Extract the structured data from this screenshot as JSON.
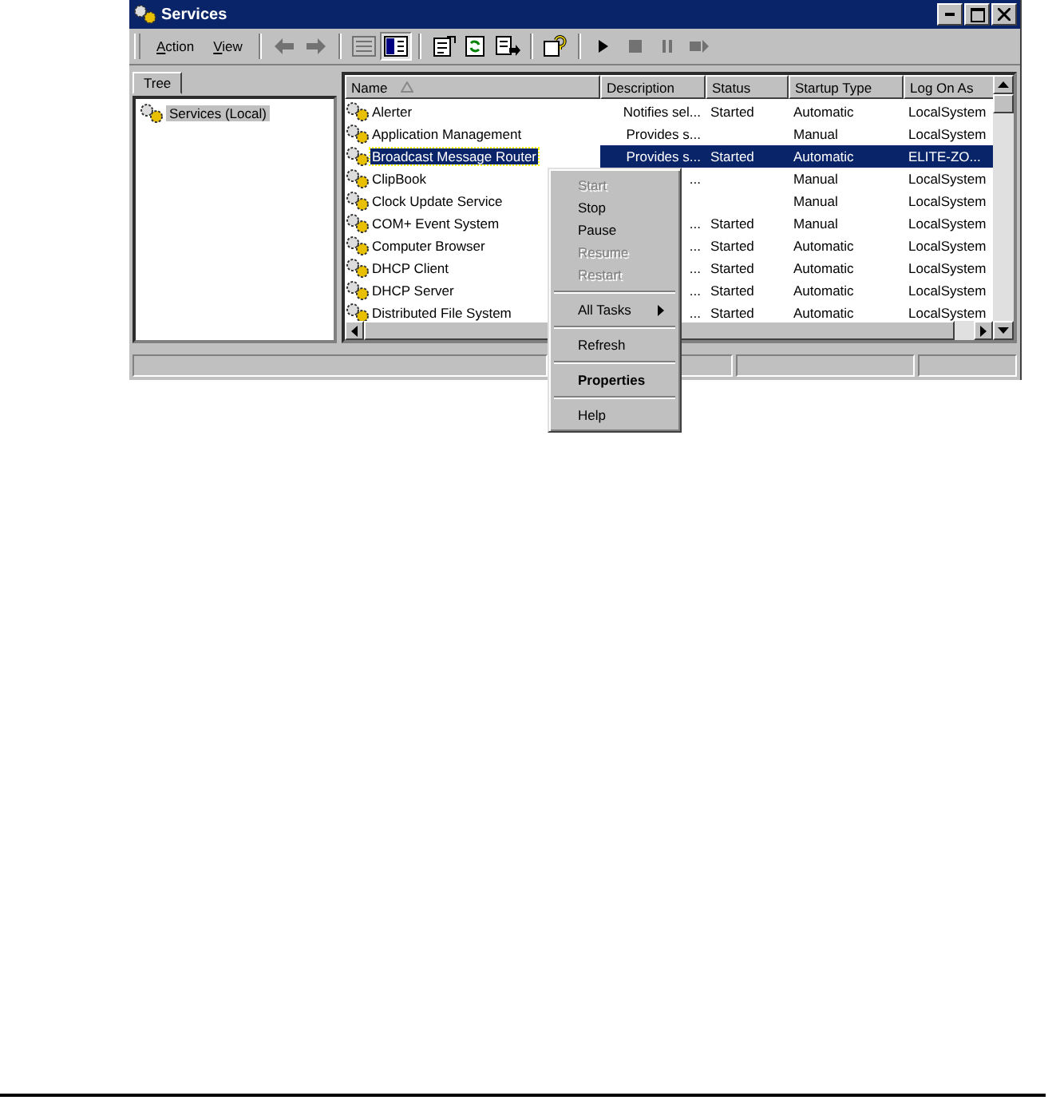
{
  "window": {
    "title": "Services"
  },
  "menu": [
    {
      "label": "Action"
    },
    {
      "label": "View"
    }
  ],
  "toolbar_groups": [
    [
      {
        "kind": "back",
        "disabled": true,
        "pressed": false
      },
      {
        "kind": "forward",
        "disabled": true,
        "pressed": false
      }
    ],
    [
      {
        "kind": "list",
        "disabled": true,
        "pressed": false
      },
      {
        "kind": "tree",
        "disabled": false,
        "pressed": true
      }
    ],
    [
      {
        "kind": "props",
        "disabled": false,
        "pressed": false
      },
      {
        "kind": "refresh",
        "disabled": false,
        "pressed": false
      },
      {
        "kind": "export",
        "disabled": false,
        "pressed": false
      }
    ],
    [
      {
        "kind": "help",
        "disabled": false,
        "pressed": false
      }
    ],
    [
      {
        "kind": "play",
        "disabled": false,
        "pressed": false
      },
      {
        "kind": "stop",
        "disabled": true,
        "pressed": false
      },
      {
        "kind": "pause",
        "disabled": true,
        "pressed": false
      },
      {
        "kind": "restart",
        "disabled": true,
        "pressed": false
      }
    ]
  ],
  "tree": {
    "tab": "Tree",
    "items": [
      {
        "label": "Services (Local)",
        "selected": true
      }
    ]
  },
  "table": {
    "columns": [
      {
        "label": "Name",
        "sorted": true
      },
      {
        "label": "Description",
        "sorted": false
      },
      {
        "label": "Status",
        "sorted": false
      },
      {
        "label": "Startup Type",
        "sorted": false
      },
      {
        "label": "Log On As",
        "sorted": false
      }
    ],
    "rows": [
      {
        "name": "Alerter",
        "description": "Notifies sel...",
        "status": "Started",
        "startup_type": "Automatic",
        "log_on_as": "LocalSystem",
        "selected": false
      },
      {
        "name": "Application Management",
        "description": "Provides s...",
        "status": "",
        "startup_type": "Manual",
        "log_on_as": "LocalSystem",
        "selected": false
      },
      {
        "name": "Broadcast Message Router",
        "description": "Provides s...",
        "status": "Started",
        "startup_type": "Automatic",
        "log_on_as": "ELITE-ZO...",
        "selected": true
      },
      {
        "name": "ClipBook",
        "description": "...",
        "status": "",
        "startup_type": "Manual",
        "log_on_as": "LocalSystem",
        "selected": false
      },
      {
        "name": "Clock Update Service",
        "description": "",
        "status": "",
        "startup_type": "Manual",
        "log_on_as": "LocalSystem",
        "selected": false
      },
      {
        "name": "COM+ Event System",
        "description": "...",
        "status": "Started",
        "startup_type": "Manual",
        "log_on_as": "LocalSystem",
        "selected": false
      },
      {
        "name": "Computer Browser",
        "description": "...",
        "status": "Started",
        "startup_type": "Automatic",
        "log_on_as": "LocalSystem",
        "selected": false
      },
      {
        "name": "DHCP Client",
        "description": "...",
        "status": "Started",
        "startup_type": "Automatic",
        "log_on_as": "LocalSystem",
        "selected": false
      },
      {
        "name": "DHCP Server",
        "description": "...",
        "status": "Started",
        "startup_type": "Automatic",
        "log_on_as": "LocalSystem",
        "selected": false
      },
      {
        "name": "Distributed File System",
        "description": "...",
        "status": "Started",
        "startup_type": "Automatic",
        "log_on_as": "LocalSystem",
        "selected": false
      }
    ]
  },
  "context_menu": [
    {
      "kind": "item",
      "label": "Start",
      "disabled": true,
      "bold": false,
      "submenu": false
    },
    {
      "kind": "item",
      "label": "Stop",
      "disabled": false,
      "bold": false,
      "submenu": false
    },
    {
      "kind": "item",
      "label": "Pause",
      "disabled": false,
      "bold": false,
      "submenu": false
    },
    {
      "kind": "item",
      "label": "Resume",
      "disabled": true,
      "bold": false,
      "submenu": false
    },
    {
      "kind": "item",
      "label": "Restart",
      "disabled": true,
      "bold": false,
      "submenu": false
    },
    {
      "kind": "separator"
    },
    {
      "kind": "item",
      "label": "All Tasks",
      "disabled": false,
      "bold": false,
      "submenu": true
    },
    {
      "kind": "separator"
    },
    {
      "kind": "item",
      "label": "Refresh",
      "disabled": false,
      "bold": false,
      "submenu": false
    },
    {
      "kind": "separator"
    },
    {
      "kind": "item",
      "label": "Properties",
      "disabled": false,
      "bold": true,
      "submenu": false
    },
    {
      "kind": "separator"
    },
    {
      "kind": "item",
      "label": "Help",
      "disabled": false,
      "bold": false,
      "submenu": false
    }
  ]
}
